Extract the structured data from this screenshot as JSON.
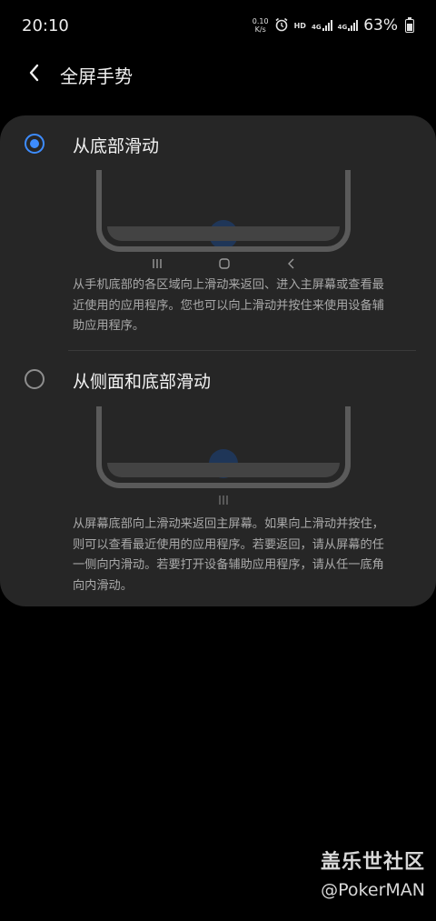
{
  "status_bar": {
    "time": "20:10",
    "net_speed_value": "0.10",
    "net_speed_unit": "K/s",
    "hd_label": "HD",
    "net1": "4G",
    "net2": "4G",
    "battery_percent": "63%",
    "icons": [
      "alarm-icon",
      "signal-icon",
      "signal-icon",
      "battery-icon"
    ]
  },
  "header": {
    "title": "全屏手势",
    "back_icon": "chevron-left-icon"
  },
  "options": [
    {
      "title": "从底部滑动",
      "selected": true,
      "description": "从手机底部的各区域向上滑动来返回、进入主屏幕或查看最近使用的应用程序。您也可以向上滑动并按住来使用设备辅助应用程序。"
    },
    {
      "title": "从侧面和底部滑动",
      "selected": false,
      "description": "从屏幕底部向上滑动来返回主屏幕。如果向上滑动并按住，则可以查看最近使用的应用程序。若要返回，请从屏幕的任一侧向内滑动。若要打开设备辅助应用程序，请从任一底角向内滑动。"
    }
  ],
  "colors": {
    "accent": "#3d8cff",
    "card_bg": "#262626",
    "page_bg": "#000000"
  },
  "watermark": {
    "title": "盖乐世社区",
    "user": "@PokerMAN"
  }
}
